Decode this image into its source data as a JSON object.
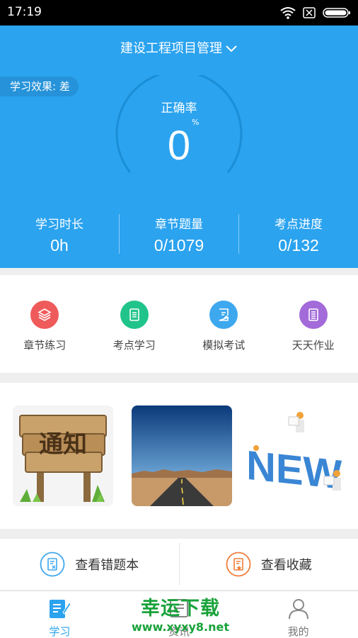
{
  "status_bar": {
    "time": "17:19"
  },
  "header": {
    "project_title": "建设工程项目管理"
  },
  "learning_effect": {
    "label": "学习效果: 差"
  },
  "accuracy": {
    "label": "正确率",
    "value": "0",
    "unit": "%"
  },
  "stats": [
    {
      "label": "学习时长",
      "value": "0h"
    },
    {
      "label": "章节题量",
      "value": "0/1079"
    },
    {
      "label": "考点进度",
      "value": "0/132"
    }
  ],
  "menu": [
    {
      "label": "章节练习",
      "icon": "layers-icon",
      "color": "#ef5a5a"
    },
    {
      "label": "考点学习",
      "icon": "document-icon",
      "color": "#20c48a"
    },
    {
      "label": "模拟考试",
      "icon": "exam-icon",
      "color": "#3ea8ef"
    },
    {
      "label": "天天作业",
      "icon": "list-icon",
      "color": "#a36ad9"
    }
  ],
  "banners": [
    {
      "name": "notice-sign",
      "text": "通知"
    },
    {
      "name": "road",
      "text": ""
    },
    {
      "name": "news",
      "text": "NEW"
    }
  ],
  "shortcuts": [
    {
      "label": "查看错题本",
      "icon": "wrong-book-icon",
      "color": "#3ea8ef"
    },
    {
      "label": "查看收藏",
      "icon": "favorites-icon",
      "color": "#f07d3a"
    }
  ],
  "tabbar": [
    {
      "label": "学习",
      "icon": "study-icon",
      "active": true
    },
    {
      "label": "资讯",
      "icon": "news-icon",
      "active": false
    },
    {
      "label": "我的",
      "icon": "profile-icon",
      "active": false
    }
  ],
  "watermark": {
    "title": "幸运下载",
    "url": "www.xyxy8.net"
  },
  "colors": {
    "primary": "#2ba3ef",
    "badge": "#2592d9",
    "watermark": "#19a23a"
  }
}
